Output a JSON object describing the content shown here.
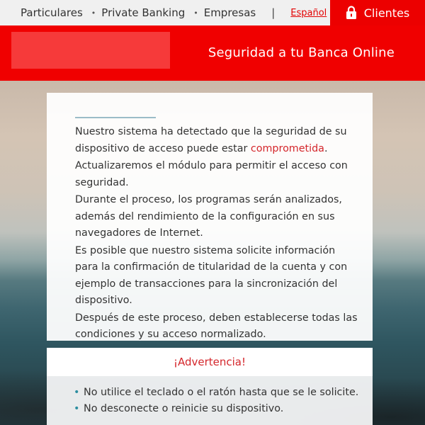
{
  "nav": {
    "items": [
      "Particulares",
      "Private Banking",
      "Empresas"
    ],
    "separator": "|",
    "language": "Español",
    "clients_label": "Clientes"
  },
  "header": {
    "title": "Seguridad a tu Banca Online"
  },
  "message": {
    "p1_before": "Nuestro sistema ha detectado que la seguridad de su dispositivo de acceso puede estar ",
    "p1_highlight": "comprometida",
    "p1_after": ".",
    "p2": "Actualizaremos el módulo para permitir el acceso con seguridad.",
    "p3": "Durante el proceso, los programas serán analizados, además del rendimiento de la configuración en sus navegadores de Internet.",
    "p4": "Es posible que nuestro sistema solicite información para la confirmación de titularidad de la cuenta y con ejemplo de transacciones para la sincronización del dispositivo.",
    "p5": "Después de este proceso, deben establecerse todas las condiciones y su acceso normalizado."
  },
  "warning": {
    "title": "¡Advertencia!",
    "items": [
      "No utilice el teclado o el ratón hasta que se le solicite.",
      "No desconecte o reinicie su dispositivo."
    ]
  },
  "colors": {
    "brand_red": "#ec0000",
    "header_red": "#f00000",
    "highlight_red": "#d4262b",
    "bullet_teal": "#2c8ea0"
  },
  "icons": {
    "clients": "lock-icon"
  }
}
